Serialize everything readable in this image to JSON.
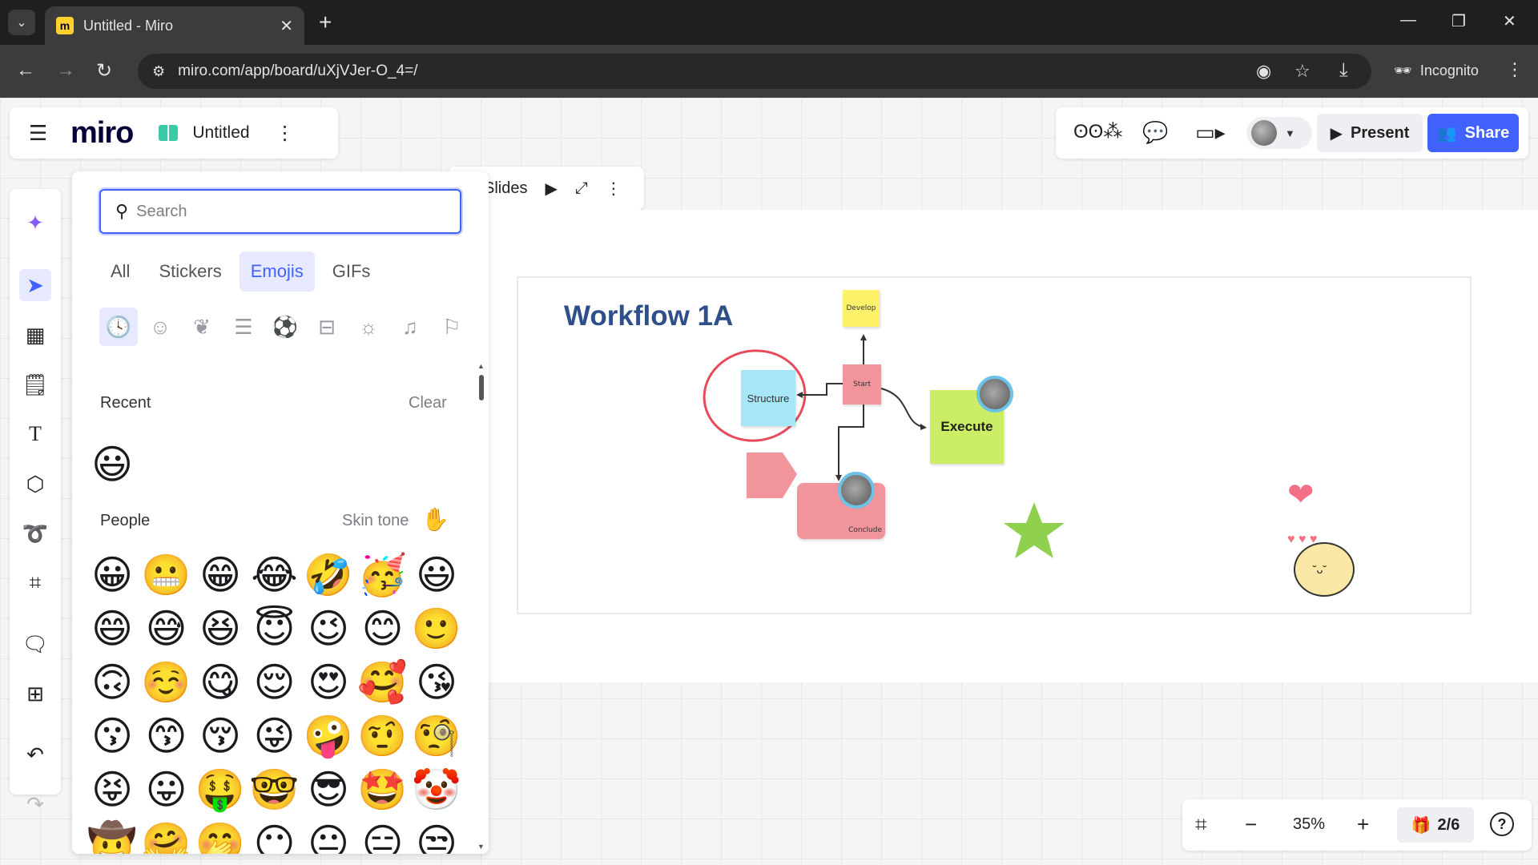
{
  "browser": {
    "tab_title": "Untitled - Miro",
    "url": "miro.com/app/board/uXjVJer-O_4=/",
    "incognito_label": "Incognito"
  },
  "board": {
    "logo": "miro",
    "title": "Untitled"
  },
  "header": {
    "present_label": "Present",
    "share_label": "Share"
  },
  "slides": {
    "label": "Slides"
  },
  "canvas": {
    "frame_title": "Workflow 1A",
    "nodes": {
      "develop": "Develop",
      "structure": "Structure",
      "start": "Start",
      "execute": "Execute",
      "conclude": "Conclude"
    }
  },
  "panel": {
    "search_placeholder": "Search",
    "tabs": [
      "All",
      "Stickers",
      "Emojis",
      "GIFs"
    ],
    "active_tab": "Emojis",
    "recent_title": "Recent",
    "clear_label": "Clear",
    "people_title": "People",
    "skin_tone_label": "Skin tone",
    "recent_emojis": [
      "😃"
    ],
    "people_emojis": [
      [
        "😀",
        "😬",
        "😁",
        "😂",
        "🤣",
        "🥳",
        "😃"
      ],
      [
        "😄",
        "😅",
        "😆",
        "😇",
        "😉",
        "😊",
        "🙂"
      ],
      [
        "🙃",
        "☺️",
        "😋",
        "😌",
        "😍",
        "🥰",
        "😘"
      ],
      [
        "😗",
        "😙",
        "😚",
        "😜",
        "🤪",
        "🤨",
        "🧐"
      ],
      [
        "😝",
        "😛",
        "🤑",
        "🤓",
        "😎",
        "🤩",
        "🤡"
      ],
      [
        "🤠",
        "🤗",
        "🤭",
        "😶",
        "😐",
        "😑",
        "😒"
      ]
    ]
  },
  "bottom": {
    "zoom": "35%",
    "pager": "2/6",
    "help": "?"
  }
}
